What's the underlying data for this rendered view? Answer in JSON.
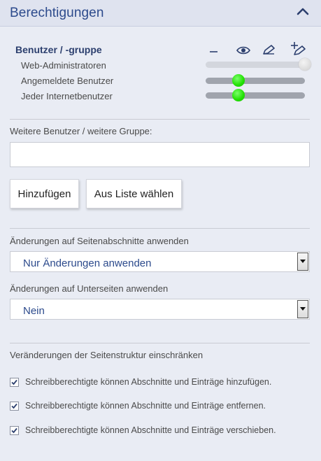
{
  "panel": {
    "title": "Berechtigungen"
  },
  "permissions": {
    "column_heading": "Benutzer / -gruppe",
    "icons": [
      "minus-icon",
      "eye-icon",
      "pencil-icon",
      "add-edit-icon"
    ],
    "rows": [
      {
        "label": "Web-Administratoren",
        "level": "max"
      },
      {
        "label": "Angemeldete Benutzer",
        "level": "read"
      },
      {
        "label": "Jeder Internetbenutzer",
        "level": "read"
      }
    ]
  },
  "additional": {
    "label": "Weitere Benutzer / weitere Gruppe:",
    "input_value": "",
    "add_button": "Hinzufügen",
    "choose_button": "Aus Liste wählen"
  },
  "sections": {
    "label": "Änderungen auf Seitenabschnitte anwenden",
    "selected": "Nur Änderungen anwenden"
  },
  "subpages": {
    "label": "Änderungen auf Unterseiten anwenden",
    "selected": "Nein"
  },
  "structure": {
    "label": "Veränderungen der Seitenstruktur einschränken",
    "options": [
      {
        "label": "Schreibberechtigte können Abschnitte und Einträge hinzufügen.",
        "checked": true
      },
      {
        "label": "Schreibberechtigte können Abschnitte und Einträge entfernen.",
        "checked": true
      },
      {
        "label": "Schreibberechtigte können Abschnitte und Einträge verschieben.",
        "checked": true
      }
    ]
  },
  "colors": {
    "accent": "#2c4a8c",
    "header_bg": "#dfe3ef",
    "body_bg": "#e9ecf4",
    "knob_active": "#20e000"
  }
}
